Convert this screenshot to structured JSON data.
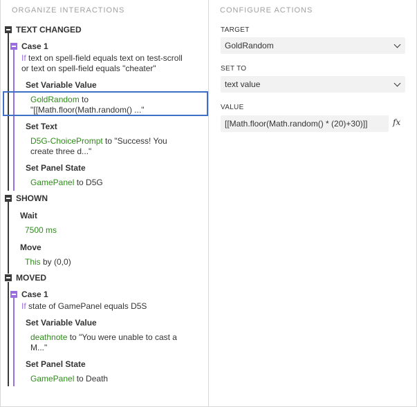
{
  "left": {
    "title": "ORGANIZE INTERACTIONS",
    "events": [
      {
        "label": "TEXT CHANGED",
        "case_label": "Case 1",
        "condition_kw": "If",
        "condition_line1": " text on spell-field equals text on test-scroll",
        "condition_line2": "or text on spell-field equals \"cheater\"",
        "actions": [
          {
            "title": "Set Variable Value",
            "target": "GoldRandom",
            "rest1": " to",
            "line2": "\"[[Math.floor(Math.random() ...\""
          },
          {
            "title": "Set Text",
            "target": "D5G-ChoicePrompt",
            "rest1": " to \"Success! You",
            "line2": "create three d...\""
          },
          {
            "title": "Set Panel State",
            "target": "GamePanel",
            "rest1": " to D5G"
          }
        ]
      },
      {
        "label": "SHOWN",
        "actions": [
          {
            "title": "Wait",
            "target": "7500 ms"
          },
          {
            "title": "Move",
            "target": "This",
            "rest1": " by (0,0)"
          }
        ]
      },
      {
        "label": "MOVED",
        "case_label": "Case 1",
        "condition_kw": "If",
        "condition_line1": " state of GamePanel equals D5S",
        "actions": [
          {
            "title": "Set Variable Value",
            "target": "deathnote",
            "rest1": " to \"You were unable to cast a",
            "line2": "M...\""
          },
          {
            "title": "Set Panel State",
            "target": "GamePanel",
            "rest1": " to Death"
          }
        ]
      }
    ]
  },
  "right": {
    "title": "CONFIGURE ACTIONS",
    "target_label": "TARGET",
    "target_value": "GoldRandom",
    "setto_label": "SET TO",
    "setto_value": "text value",
    "value_label": "VALUE",
    "value_text": "[[Math.floor(Math.random() * (20)+30)]]",
    "fx_icon": "fx"
  },
  "colors": {
    "accent_green": "#2e8b1a",
    "case_purple": "#9b6ee0",
    "selection_blue": "#3d6fc4"
  }
}
